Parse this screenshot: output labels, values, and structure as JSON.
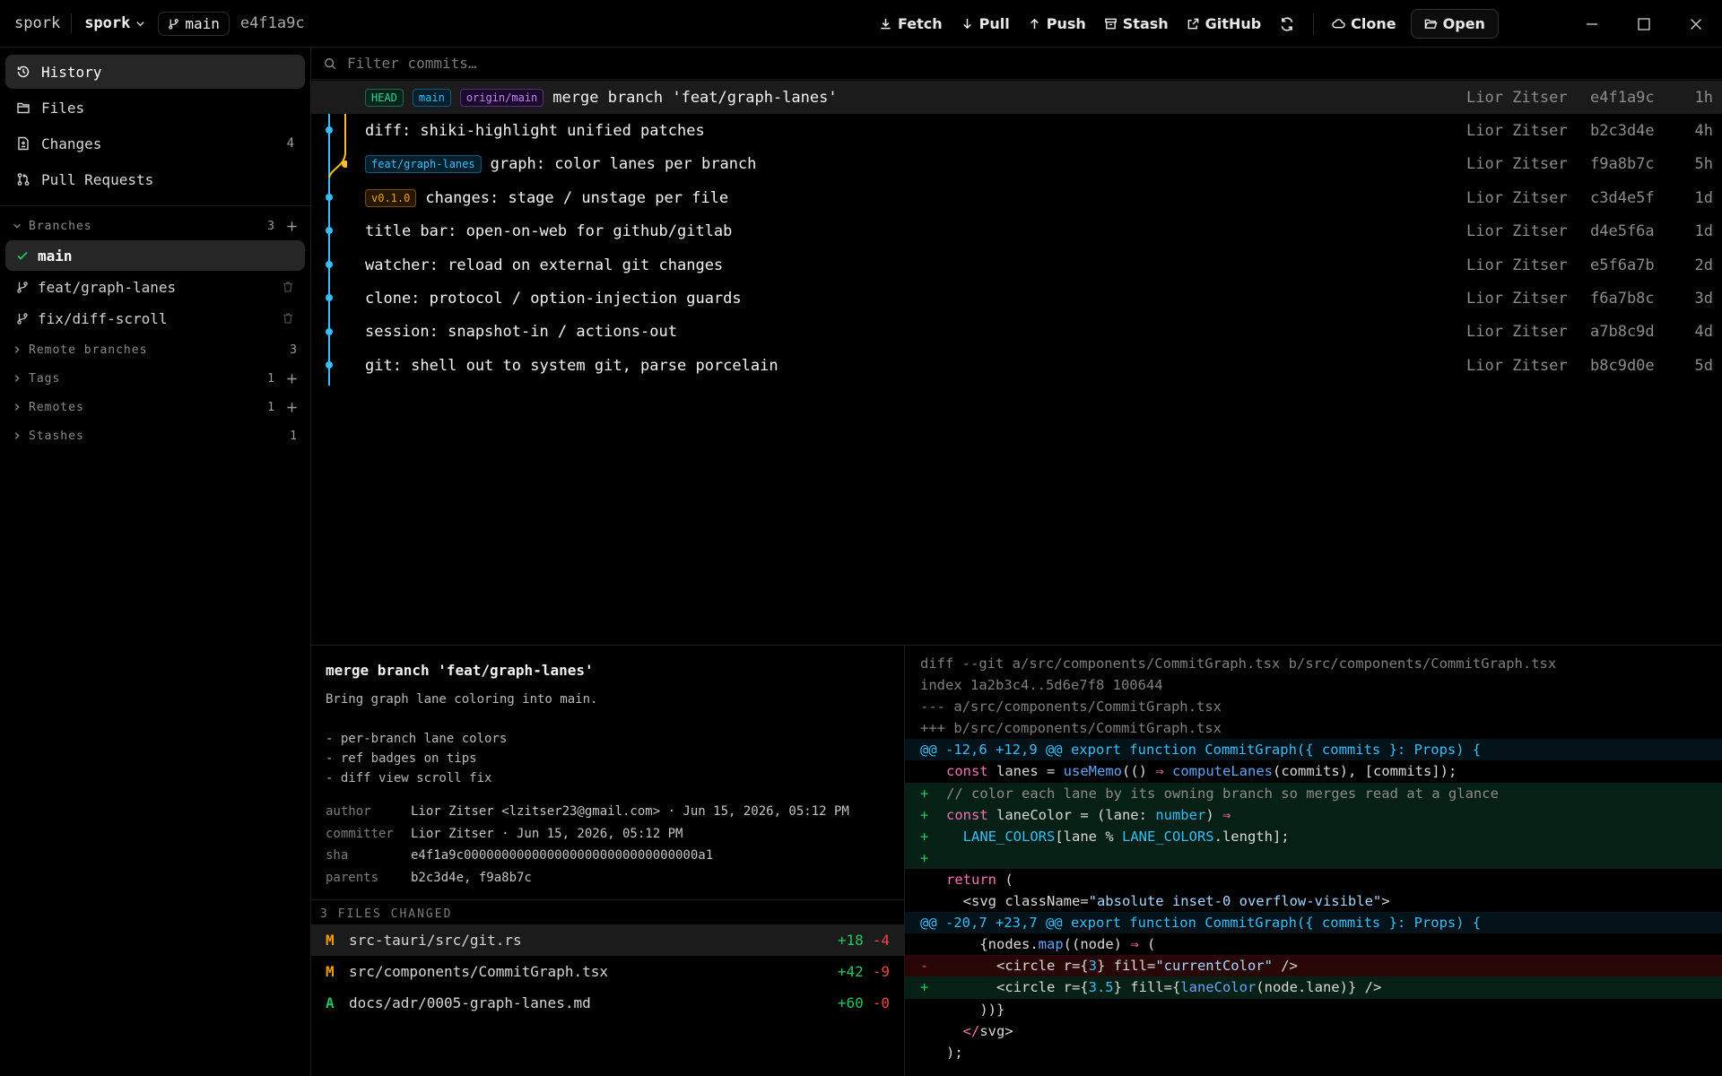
{
  "titlebar": {
    "app_name": "spork",
    "repo_name": "spork",
    "branch": "main",
    "head_sha": "e4f1a9c",
    "actions": {
      "fetch": "Fetch",
      "pull": "Pull",
      "push": "Push",
      "stash": "Stash",
      "github": "GitHub",
      "clone": "Clone",
      "open": "Open"
    }
  },
  "sidebar": {
    "nav": [
      {
        "label": "History",
        "icon": "history-icon",
        "count": ""
      },
      {
        "label": "Files",
        "icon": "files-icon",
        "count": ""
      },
      {
        "label": "Changes",
        "icon": "changes-icon",
        "count": "4"
      },
      {
        "label": "Pull Requests",
        "icon": "pull-request-icon",
        "count": ""
      }
    ],
    "branches": {
      "label": "Branches",
      "count": "3",
      "items": [
        "main",
        "feat/graph-lanes",
        "fix/diff-scroll"
      ]
    },
    "remote_branches": {
      "label": "Remote branches",
      "count": "3"
    },
    "tags": {
      "label": "Tags",
      "count": "1"
    },
    "remotes": {
      "label": "Remotes",
      "count": "1"
    },
    "stashes": {
      "label": "Stashes",
      "count": "1"
    }
  },
  "filter": {
    "placeholder": "Filter commits…"
  },
  "commits": [
    {
      "refs": [
        "HEAD",
        "main",
        "origin/main"
      ],
      "message": "merge branch 'feat/graph-lanes'",
      "author": "Lior Zitser",
      "sha": "e4f1a9c",
      "age": "1h"
    },
    {
      "refs": [],
      "message": "diff: shiki-highlight unified patches",
      "author": "Lior Zitser",
      "sha": "b2c3d4e",
      "age": "4h"
    },
    {
      "refs": [
        "feat/graph-lanes"
      ],
      "message": "graph: color lanes per branch",
      "author": "Lior Zitser",
      "sha": "f9a8b7c",
      "age": "5h"
    },
    {
      "refs": [
        "v0.1.0"
      ],
      "message": "changes: stage / unstage per file",
      "author": "Lior Zitser",
      "sha": "c3d4e5f",
      "age": "1d"
    },
    {
      "refs": [],
      "message": "title bar: open-on-web for github/gitlab",
      "author": "Lior Zitser",
      "sha": "d4e5f6a",
      "age": "1d"
    },
    {
      "refs": [],
      "message": "watcher: reload on external git changes",
      "author": "Lior Zitser",
      "sha": "e5f6a7b",
      "age": "2d"
    },
    {
      "refs": [],
      "message": "clone: protocol / option-injection guards",
      "author": "Lior Zitser",
      "sha": "f6a7b8c",
      "age": "3d"
    },
    {
      "refs": [],
      "message": "session: snapshot-in / actions-out",
      "author": "Lior Zitser",
      "sha": "a7b8c9d",
      "age": "4d"
    },
    {
      "refs": [],
      "message": "git: shell out to system git, parse porcelain",
      "author": "Lior Zitser",
      "sha": "b8c9d0e",
      "age": "5d"
    }
  ],
  "detail": {
    "title": "merge branch 'feat/graph-lanes'",
    "body": "Bring graph lane coloring into main.\n\n- per-branch lane colors\n- ref badges on tips\n- diff view scroll fix",
    "meta": {
      "author_label": "author",
      "author": "Lior Zitser <lzitser23@gmail.com> · Jun 15, 2026, 05:12 PM",
      "committer_label": "committer",
      "committer": "Lior Zitser · Jun 15, 2026, 05:12 PM",
      "sha_label": "sha",
      "sha": "e4f1a9c0000000000000000000000000000000a1",
      "parents_label": "parents",
      "parents": "b2c3d4e, f9a8b7c"
    },
    "files_header": "3 FILES CHANGED",
    "files": [
      {
        "status": "M",
        "path": "src-tauri/src/git.rs",
        "add": "+18",
        "del": "-4"
      },
      {
        "status": "M",
        "path": "src/components/CommitGraph.tsx",
        "add": "+42",
        "del": "-9"
      },
      {
        "status": "A",
        "path": "docs/adr/0005-graph-lanes.md",
        "add": "+60",
        "del": "-0"
      }
    ]
  },
  "diff": {
    "header": [
      "diff --git a/src/components/CommitGraph.tsx b/src/components/CommitGraph.tsx",
      "index 1a2b3c4..5d6e7f8 100644",
      "--- a/src/components/CommitGraph.tsx",
      "+++ b/src/components/CommitGraph.tsx"
    ],
    "hunk1": "@@ -12,6 +12,9 @@ export function CommitGraph({ commits }: Props) {",
    "hunk2": "@@ -20,7 +23,7 @@ export function CommitGraph({ commits }: Props) {"
  },
  "colors": {
    "accent_blue": "#38bdf8",
    "lane_yellow": "#fbbf24",
    "add_green": "#22c55e",
    "del_red": "#ef4444",
    "modified_orange": "#f59e0b"
  }
}
